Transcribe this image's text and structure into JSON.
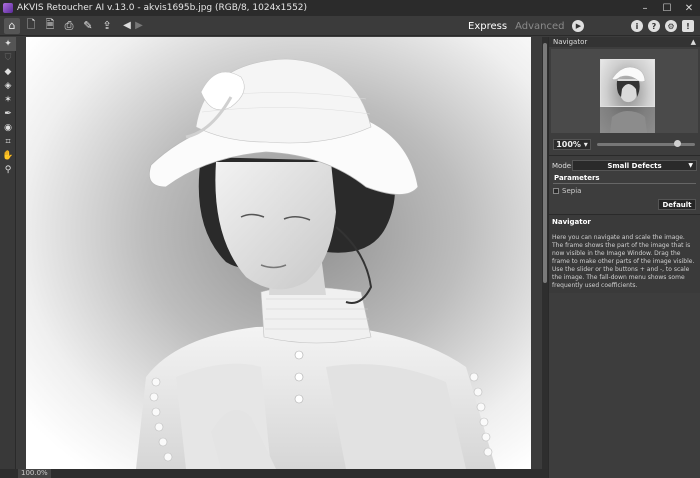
{
  "window": {
    "title": "AKVIS Retoucher AI v.13.0 - akvis1695b.jpg (RGB/8, 1024x1552)",
    "controls": {
      "minimize": "–",
      "maximize": "☐",
      "close": "✕"
    }
  },
  "toolbar": {
    "icons": [
      "home-icon",
      "open-file-icon",
      "save-file-icon",
      "print-icon",
      "preferences-icon",
      "share-icon"
    ],
    "mode_express": "Express",
    "mode_advanced": "Advanced",
    "run_icon": "play-icon",
    "right_icons": [
      "info-icon",
      "help-icon",
      "settings-icon",
      "notification-icon"
    ]
  },
  "tools": [
    "retouch-tool-icon",
    "shield-tool-icon",
    "eraser-icon",
    "bucket-icon",
    "magic-wand-icon",
    "brush-icon",
    "clone-stamp-icon",
    "crop-icon",
    "hand-icon",
    "zoom-icon"
  ],
  "status": {
    "zoom": "100.0%"
  },
  "navigator": {
    "title": "Navigator",
    "zoom_value": "100%",
    "slider_fraction": 0.82
  },
  "settings": {
    "mode_label": "Mode:",
    "mode_value": "Small Defects",
    "parameters_title": "Parameters",
    "sepia_label": "Sepia",
    "sepia_checked": false,
    "default_button": "Default"
  },
  "help": {
    "title": "Navigator",
    "text": "Here you can navigate and scale the image. The frame shows the part of the image that is now visible in the Image Window. Drag the frame to make other parts of the image visible. Use the slider or the buttons + and -, to scale the image. The fall-down menu shows some frequently used coefficients."
  },
  "colors": {
    "background": "#3c3c3c",
    "panel": "#3d3d3d",
    "accent": "#e0e0e0"
  }
}
